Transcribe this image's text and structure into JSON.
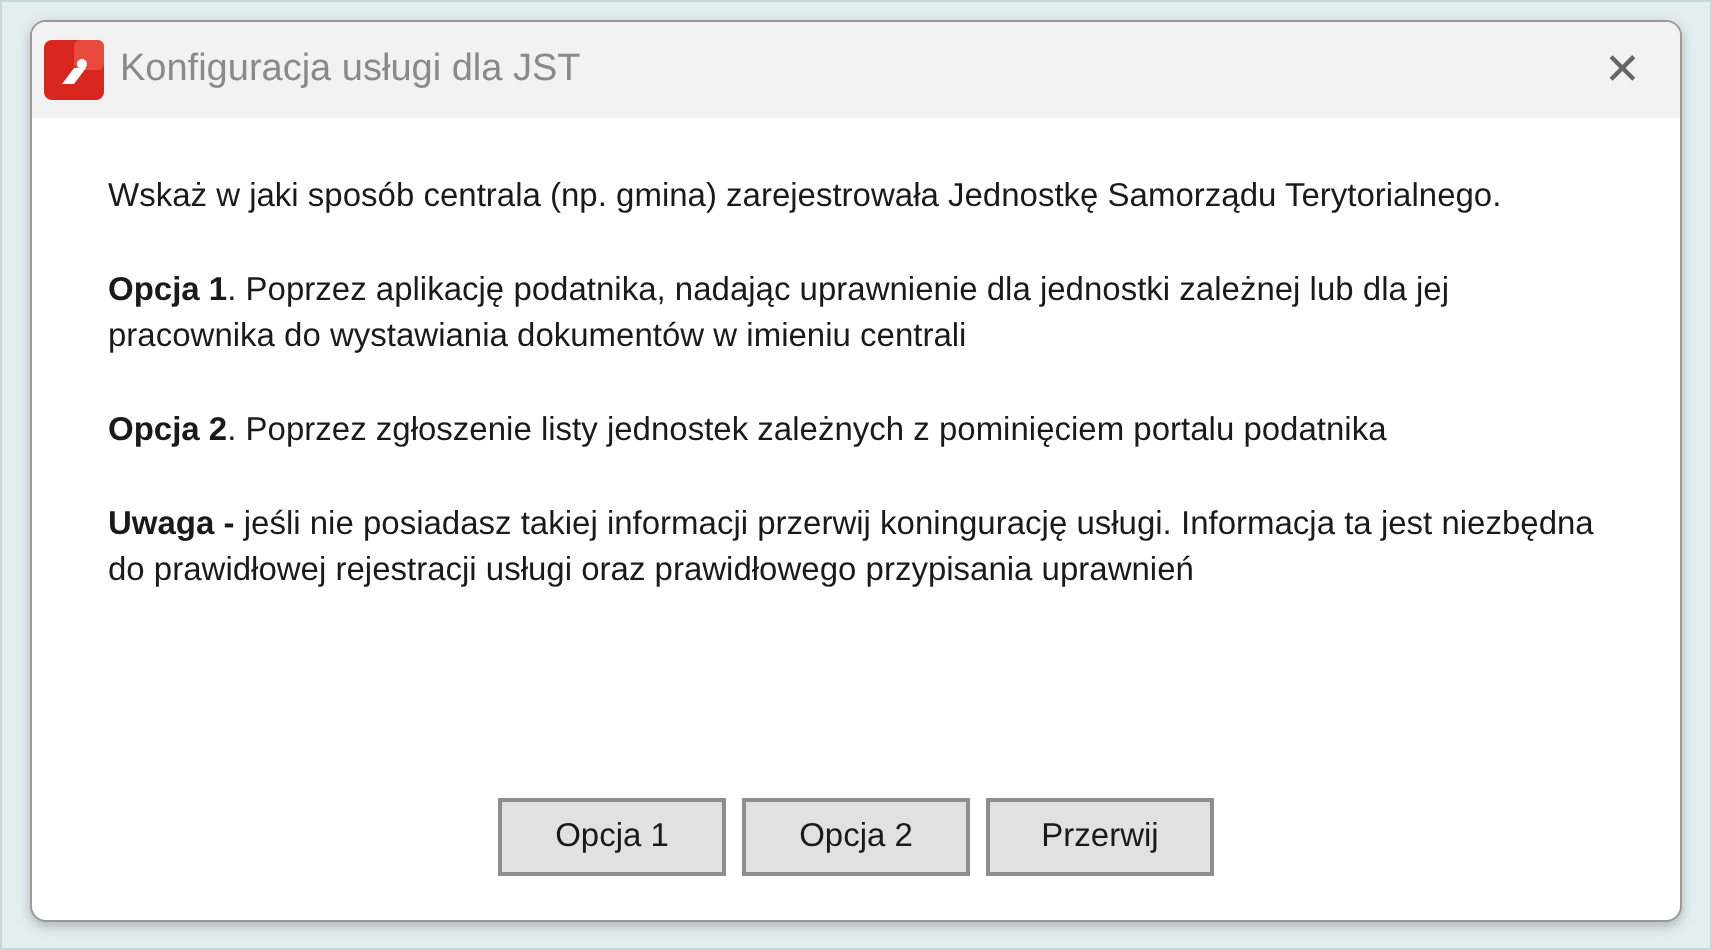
{
  "window": {
    "title": "Konfiguracja usługi dla JST",
    "close": "✕"
  },
  "paragraphs": [
    "Wskaż w jaki sposób centrala (np. gmina) zarejestrowała Jednostkę Samorządu Terytorialnego.",
    "**Opcja 1**. Poprzez aplikację podatnika, nadając uprawnienie dla jednostki zależnej lub dla jej pracownika do wystawiania dokumentów w imieniu centrali",
    "**Opcja 2**. Poprzez zgłoszenie listy jednostek zależnych z pominięciem portalu podatnika",
    "**Uwaga -** jeśli nie posiadasz takiej informacji przerwij koningurację usługi. Informacja ta jest niezbędna do prawidłowej rejestracji usługi oraz prawidłowego przypisania uprawnień"
  ],
  "buttons": [
    "Opcja 1",
    "Opcja 2",
    "Przerwij"
  ]
}
